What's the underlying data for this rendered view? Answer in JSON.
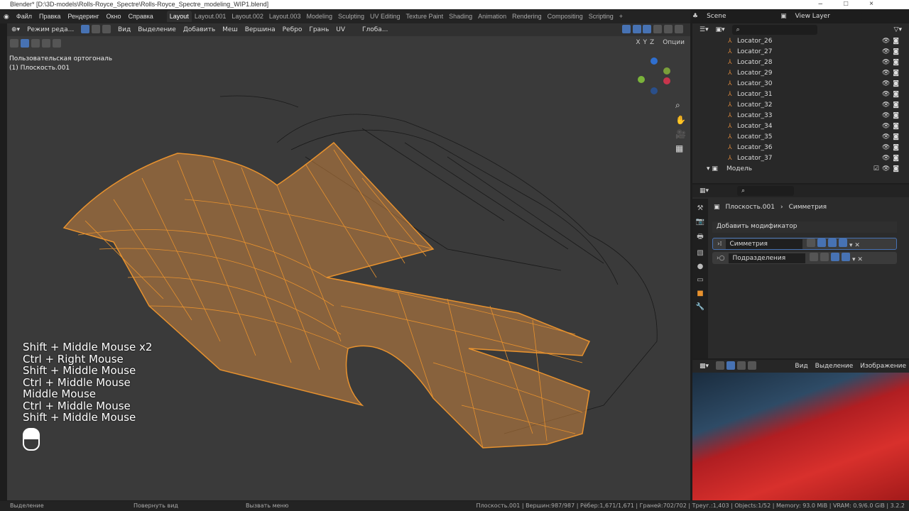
{
  "title": "Blender* [D:\\3D-models\\Rolls-Royce_Spectre\\Rolls-Royce_Spectre_modeling_WIP1.blend]",
  "menu": [
    "Файл",
    "Правка",
    "Рендеринг",
    "Окно",
    "Справка"
  ],
  "workspaces": [
    "Layout",
    "Layout.001",
    "Layout.002",
    "Layout.003",
    "Modeling",
    "Sculpting",
    "UV Editing",
    "Texture Paint",
    "Shading",
    "Animation",
    "Rendering",
    "Compositing",
    "Scripting",
    "+"
  ],
  "scene": "Scene",
  "view_layer": "View Layer",
  "header": {
    "mode": "Режим реда...",
    "items": [
      "Вид",
      "Выделение",
      "Добавить",
      "Меш",
      "Вершина",
      "Ребро",
      "Грань",
      "UV"
    ],
    "orientation": "Глоба...",
    "options": "Опции"
  },
  "viewport": {
    "view_name": "Пользовательская ортогональ",
    "object": "(1) Плоскость.001",
    "axes": [
      "X",
      "Y",
      "Z"
    ]
  },
  "key_hints": [
    "Shift + Middle Mouse x2",
    "Ctrl + Right Mouse",
    "Shift + Middle Mouse",
    "Ctrl + Middle Mouse",
    "Middle Mouse",
    "Ctrl + Middle Mouse",
    "Shift + Middle Mouse"
  ],
  "outliner": {
    "items": [
      "Locator_26",
      "Locator_27",
      "Locator_28",
      "Locator_29",
      "Locator_30",
      "Locator_31",
      "Locator_32",
      "Locator_33",
      "Locator_34",
      "Locator_35",
      "Locator_36",
      "Locator_37"
    ],
    "collection": "Модель"
  },
  "properties": {
    "object": "Плоскость.001",
    "modifier_path": "Симметрия",
    "add_modifier": "Добавить модификатор",
    "modifiers": [
      "Симметрия",
      "Подразделения"
    ]
  },
  "image_editor": {
    "menu": [
      "Вид",
      "Выделение",
      "Изображение"
    ]
  },
  "status": {
    "left": [
      "Выделение",
      "Повернуть вид",
      "Вызвать меню"
    ],
    "stats": "Плоскость.001 | Вершин:987/987 | Рёбер:1,671/1,671 | Граней:702/702 | Треуг.:1,403 | Objects:1/52 | Memory: 93.0 MiB | VRAM: 0.9/6.0 GiB | 3.2.2"
  },
  "colors": {
    "accent": "#4772b3",
    "mesh": "#e8922e"
  }
}
